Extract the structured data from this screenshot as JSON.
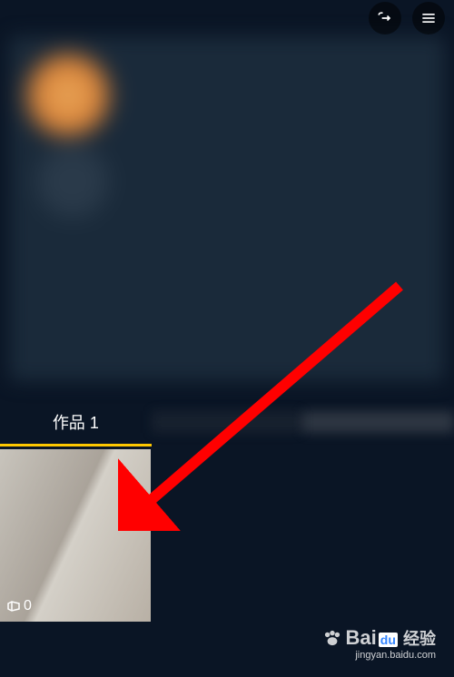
{
  "header": {
    "share_icon": "share",
    "menu_icon": "menu"
  },
  "tabs": {
    "works": {
      "label": "作品",
      "count": "1"
    }
  },
  "video": {
    "play_count": "0"
  },
  "watermark": {
    "brand": "Bai",
    "brand_suffix": "经验",
    "url": "jingyan.baidu.com"
  }
}
